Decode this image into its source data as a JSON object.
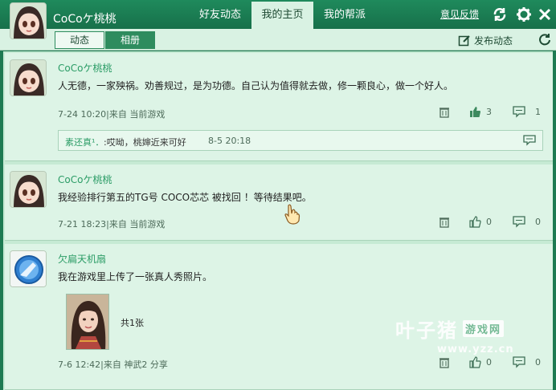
{
  "header": {
    "username": "CoCoケ桃桃",
    "tabs": [
      {
        "label": "好友动态"
      },
      {
        "label": "我的主页"
      },
      {
        "label": "我的帮派"
      }
    ],
    "feedback": "意见反馈"
  },
  "subbar": {
    "tabs": [
      {
        "label": "动态"
      },
      {
        "label": "相册"
      }
    ],
    "publish": "发布动态"
  },
  "posts": [
    {
      "author": "CoCoケ桃桃",
      "text": "人无德，一家殃祸。劝善规过，是为功德。自己认为值得就去做，修一颗良心，做一个好人。",
      "meta": "7-24 10:20|来自 当前游戏",
      "likes": "3",
      "comments": "1",
      "reply": {
        "name": "素还真¹．",
        "text": ":哎呦，桃婶近来可好",
        "time": "8-5 20:18"
      }
    },
    {
      "author": "CoCoケ桃桃",
      "text": "我经验排行第五的TG号 COCO芯芯 被找回 ！等待结果吧。",
      "meta": "7-21 18:23|来自 当前游戏",
      "likes": "0",
      "comments": "0"
    },
    {
      "author": "欠扁天机扇",
      "text": "我在游戏里上传了一张真人秀照片。",
      "photo_count": "共1张",
      "meta": "7-6 12:42|来自 神武2 分享",
      "likes": "0",
      "comments": "0"
    }
  ],
  "watermark": {
    "main": "叶子猪",
    "badge": "游戏网",
    "url": "www.yzz.cn"
  },
  "colors": {
    "header": "#1d7a52",
    "panel": "#ddf4e6",
    "accent": "#2b9c66"
  }
}
